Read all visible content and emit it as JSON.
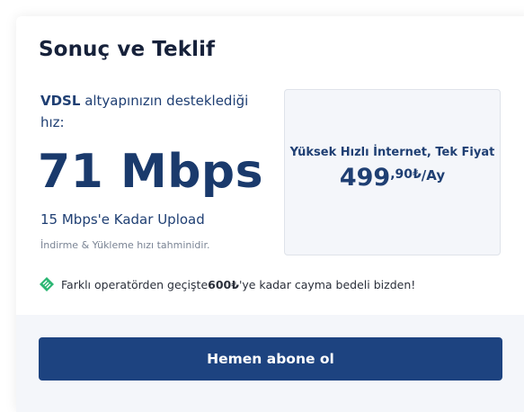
{
  "heading": "Sonuç ve Teklif",
  "tech": {
    "name": "VDSL",
    "text": " altyapınızın desteklediği hız:"
  },
  "speed": "71 Mbps",
  "upload": "15 Mbps'e Kadar Upload",
  "estimate_note": "İndirme & Yükleme hızı tahminidir.",
  "offer": {
    "title": "Yüksek Hızlı İnternet, Tek Fiyat",
    "price_main": "499",
    "price_cents": ",90₺",
    "price_unit": "/Ay"
  },
  "promo": {
    "icon": "tag-icon",
    "before": "Farklı operatörden geçişte ",
    "amount": "600₺",
    "after": "'ye kadar cayma bedeli bizden!"
  },
  "cta_label": "Hemen abone ol",
  "colors": {
    "primary": "#1d4380",
    "text_dark": "#16213a",
    "accent_green": "#2bb673",
    "panel_bg": "#f4f6fa"
  }
}
